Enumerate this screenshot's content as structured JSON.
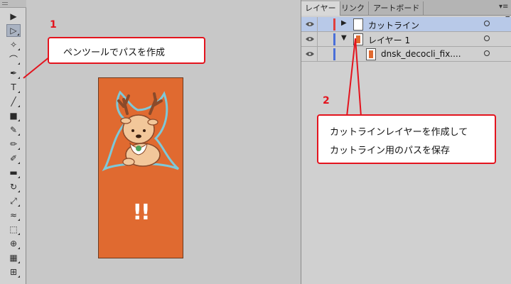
{
  "tools": [
    {
      "name": "selection-tool-icon",
      "glyph": "▶"
    },
    {
      "name": "direct-selection-tool-icon",
      "glyph": "▷"
    },
    {
      "name": "magic-wand-tool-icon",
      "glyph": "✧"
    },
    {
      "name": "lasso-tool-icon",
      "glyph": "⌒"
    },
    {
      "name": "pen-tool-icon",
      "glyph": "✒"
    },
    {
      "name": "type-tool-icon",
      "glyph": "T"
    },
    {
      "name": "line-tool-icon",
      "glyph": "╱"
    },
    {
      "name": "rectangle-tool-icon",
      "glyph": "■"
    },
    {
      "name": "paintbrush-tool-icon",
      "glyph": "✎"
    },
    {
      "name": "pencil-tool-icon",
      "glyph": "✏"
    },
    {
      "name": "blob-brush-tool-icon",
      "glyph": "✐"
    },
    {
      "name": "eraser-tool-icon",
      "glyph": "▬"
    },
    {
      "name": "rotate-tool-icon",
      "glyph": "↻"
    },
    {
      "name": "scale-tool-icon",
      "glyph": "⤢"
    },
    {
      "name": "warp-tool-icon",
      "glyph": "≈"
    },
    {
      "name": "free-transform-tool-icon",
      "glyph": "⬚"
    },
    {
      "name": "shape-builder-tool-icon",
      "glyph": "⊕"
    },
    {
      "name": "perspective-grid-tool-icon",
      "glyph": "▦"
    },
    {
      "name": "mesh-tool-icon",
      "glyph": "⊞"
    }
  ],
  "artwork": {
    "text": "!!",
    "color": "#e06a30"
  },
  "layers_panel": {
    "tabs": [
      "レイヤー",
      "リンク",
      "アートボード"
    ],
    "rows": [
      {
        "name": "カットライン",
        "color": "#e04040"
      },
      {
        "name": "レイヤー 1",
        "color": "#4a6fd8"
      },
      {
        "name": "dnsk_decocli_fix....",
        "color": "#4a6fd8"
      }
    ]
  },
  "callouts": {
    "one": {
      "number": "1",
      "text": "ペンツールでパスを作成"
    },
    "two": {
      "number": "2",
      "line1": "カットラインレイヤーを作成して",
      "line2": "カットライン用のパスを保存"
    }
  },
  "colors": {
    "accent": "#e3141e",
    "selection": "#b8c9e8"
  }
}
